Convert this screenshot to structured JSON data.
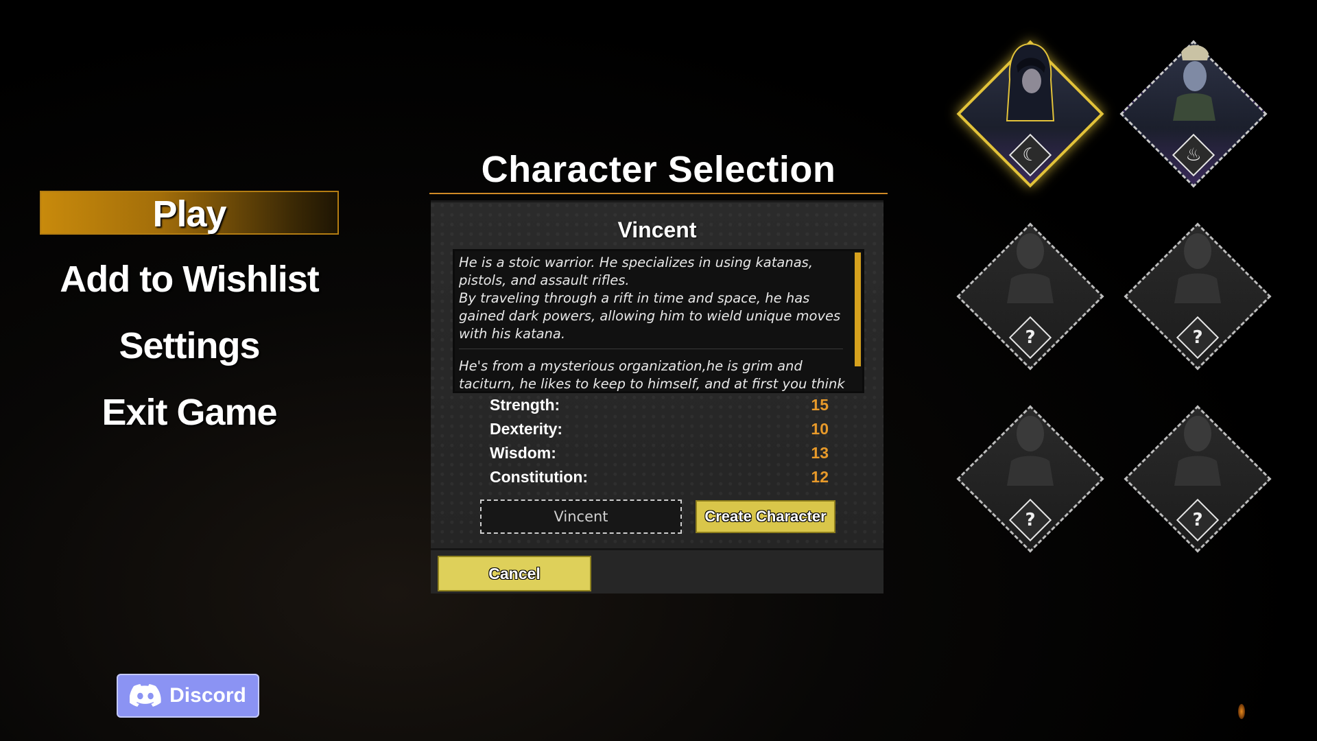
{
  "menu": {
    "items": [
      {
        "label": "Play",
        "active": true
      },
      {
        "label": "Add to Wishlist",
        "active": false
      },
      {
        "label": "Settings",
        "active": false
      },
      {
        "label": "Exit Game",
        "active": false
      }
    ]
  },
  "discord": {
    "label": "Discord",
    "icon": "discord-icon"
  },
  "selection": {
    "title": "Character Selection",
    "character_name": "Vincent",
    "description": [
      "He is a stoic warrior. He specializes in using katanas, pistols, and assault rifles.\nBy traveling through a rift in time and space, he has gained dark powers, allowing him to wield unique moves with his katana.",
      "He's from a mysterious organization,he is grim and taciturn, he likes to keep to himself, and at first you think he's cold-"
    ],
    "stats": [
      {
        "label": "Strength:",
        "value": "15"
      },
      {
        "label": "Dexterity:",
        "value": "10"
      },
      {
        "label": "Wisdom:",
        "value": "13"
      },
      {
        "label": "Constitution:",
        "value": "12"
      }
    ],
    "name_input_value": "Vincent",
    "create_label": "Create Character",
    "cancel_label": "Cancel"
  },
  "roster": {
    "slots": [
      {
        "state": "selected",
        "badge": "blade-icon"
      },
      {
        "state": "available",
        "badge": "flame-icon"
      },
      {
        "state": "locked",
        "badge": "?"
      },
      {
        "state": "locked",
        "badge": "?"
      },
      {
        "state": "locked",
        "badge": "?"
      },
      {
        "state": "locked",
        "badge": "?"
      }
    ]
  },
  "colors": {
    "accent_gold": "#d6a11e",
    "stat_value": "#e89a2a",
    "button_yellow": "#ded05a",
    "discord": "#8b93f3"
  }
}
